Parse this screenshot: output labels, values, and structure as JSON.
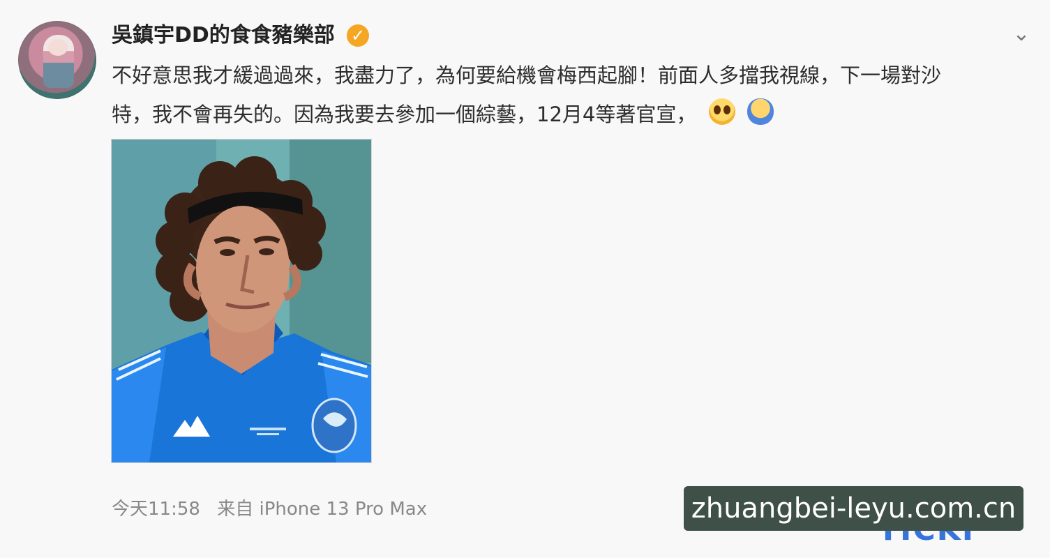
{
  "post": {
    "username": "吳鎮宇DD的食食豬樂部",
    "text_line_1": "不好意思我才緩過過來，我盡力了，為何要給機會梅西起腳！前面人多擋我視線，下一場對沙",
    "text_line_2": "特，我不會再失的。因為我要去參加一個綜藝，12月4等著官宣，",
    "meta_time": "今天11:58",
    "meta_source": "来自 iPhone 13 Pro Max",
    "watermark": "zhuangbei-leyu.com.cn",
    "watermark_fragment": "TICKI"
  },
  "icons": {
    "verified": "verified-badge-icon",
    "menu": "chevron-down-icon",
    "emoji_1": "shocked-face-emoji-icon",
    "emoji_2": "hug-emoji-icon"
  },
  "colors": {
    "background": "#f8f8f8",
    "text": "#2d2d2d",
    "meta": "#888888",
    "verified": "#f5a623",
    "watermark_bg": "#3f5048"
  }
}
